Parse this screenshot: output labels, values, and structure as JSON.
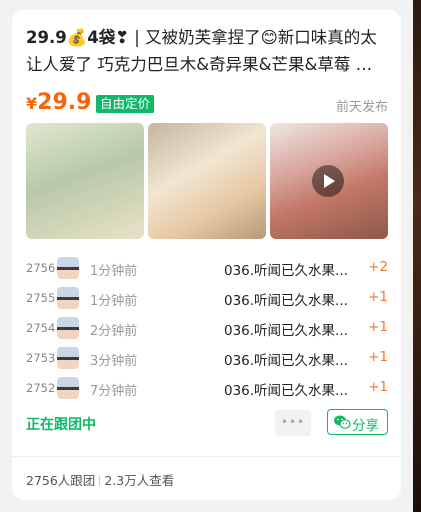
{
  "post": {
    "title_prefix": "29.9💰4袋❣",
    "title_rest": " | 又被奶芙拿捏了😊新口味真的太让人爱了 巧克力巴旦木&奇异果&芒果&草莓 四种口味...",
    "price_currency": "¥",
    "price_value": "29.9",
    "price_tag": "自由定价",
    "published": "前天发布"
  },
  "media": [
    {
      "icon": "photo",
      "kind": "image"
    },
    {
      "icon": "photo",
      "kind": "image"
    },
    {
      "icon": "play-icon",
      "kind": "video"
    }
  ],
  "orders": [
    {
      "number": "2756",
      "time": "1分钟前",
      "product": "036.听闻已久水果...",
      "count": "+2"
    },
    {
      "number": "2755",
      "time": "1分钟前",
      "product": "036.听闻已久水果...",
      "count": "+1"
    },
    {
      "number": "2754",
      "time": "2分钟前",
      "product": "036.听闻已久水果...",
      "count": "+1"
    },
    {
      "number": "2753",
      "time": "3分钟前",
      "product": "036.听闻已久水果...",
      "count": "+1"
    },
    {
      "number": "2752",
      "time": "7分钟前",
      "product": "036.听闻已久水果...",
      "count": "+1"
    }
  ],
  "actions": {
    "status": "正在跟团中",
    "more": "•••",
    "share": "分享"
  },
  "stats": {
    "joined": "2756人跟团",
    "views": "2.3万人查看"
  },
  "colors": {
    "accent_green": "#10b869",
    "price_orange": "#f5650c",
    "count_orange": "#f07a2e"
  }
}
